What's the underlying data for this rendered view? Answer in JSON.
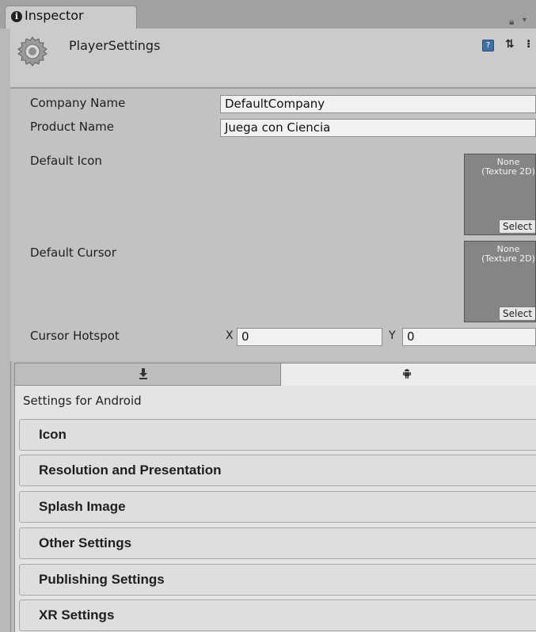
{
  "window": {
    "tab_label": "Inspector",
    "tab_icon": "info-icon"
  },
  "header": {
    "title": "PlayerSettings",
    "icons": [
      "settings-gear-icon",
      "help-icon",
      "presets-icon",
      "context-menu-icon"
    ]
  },
  "properties": {
    "company_name": {
      "label": "Company Name",
      "value": "DefaultCompany"
    },
    "product_name": {
      "label": "Product Name",
      "value": "Juega con Ciencia"
    },
    "default_icon": {
      "label": "Default Icon",
      "field_line1": "None",
      "field_line2": "(Texture 2D)",
      "select_label": "Select"
    },
    "default_cursor": {
      "label": "Default Cursor",
      "field_line1": "None",
      "field_line2": "(Texture 2D)",
      "select_label": "Select"
    },
    "cursor_hotspot": {
      "label": "Cursor Hotspot",
      "x_label": "X",
      "x_value": "0",
      "y_label": "Y",
      "y_value": "0"
    }
  },
  "platform_tabs": [
    {
      "icon": "download-arrow-icon",
      "selected": false
    },
    {
      "icon": "android-icon",
      "selected": true
    }
  ],
  "settings": {
    "title": "Settings for Android",
    "sections": [
      "Icon",
      "Resolution and Presentation",
      "Splash Image",
      "Other Settings",
      "Publishing Settings",
      "XR Settings"
    ]
  }
}
